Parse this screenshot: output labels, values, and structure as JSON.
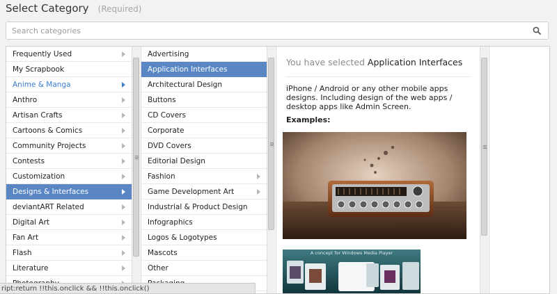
{
  "header": {
    "title": "Select Category",
    "required": "(Required)"
  },
  "search": {
    "placeholder": "Search categories",
    "value": "",
    "icon": "search-icon"
  },
  "columns": {
    "categories": [
      {
        "label": "Frequently Used",
        "has_children": true
      },
      {
        "label": "My Scrapbook",
        "has_children": false
      },
      {
        "label": "Anime & Manga",
        "has_children": true,
        "state": "active"
      },
      {
        "label": "Anthro",
        "has_children": true
      },
      {
        "label": "Artisan Crafts",
        "has_children": true
      },
      {
        "label": "Cartoons & Comics",
        "has_children": true
      },
      {
        "label": "Community Projects",
        "has_children": true
      },
      {
        "label": "Contests",
        "has_children": true
      },
      {
        "label": "Customization",
        "has_children": true
      },
      {
        "label": "Designs & Interfaces",
        "has_children": true,
        "state": "selected"
      },
      {
        "label": "deviantART Related",
        "has_children": true
      },
      {
        "label": "Digital Art",
        "has_children": true
      },
      {
        "label": "Fan Art",
        "has_children": true
      },
      {
        "label": "Flash",
        "has_children": true
      },
      {
        "label": "Literature",
        "has_children": true
      },
      {
        "label": "Photography",
        "has_children": true
      }
    ],
    "subcategories": [
      {
        "label": "Advertising",
        "has_children": false
      },
      {
        "label": "Application Interfaces",
        "has_children": false,
        "state": "selected"
      },
      {
        "label": "Architectural Design",
        "has_children": false
      },
      {
        "label": "Buttons",
        "has_children": false
      },
      {
        "label": "CD Covers",
        "has_children": false
      },
      {
        "label": "Corporate",
        "has_children": false
      },
      {
        "label": "DVD Covers",
        "has_children": false
      },
      {
        "label": "Editorial Design",
        "has_children": false
      },
      {
        "label": "Fashion",
        "has_children": true
      },
      {
        "label": "Game Development Art",
        "has_children": true
      },
      {
        "label": "Industrial & Product Design",
        "has_children": false
      },
      {
        "label": "Infographics",
        "has_children": false
      },
      {
        "label": "Logos & Logotypes",
        "has_children": false
      },
      {
        "label": "Mascots",
        "has_children": false
      },
      {
        "label": "Other",
        "has_children": false
      },
      {
        "label": "Packaging",
        "has_children": false
      }
    ]
  },
  "detail": {
    "prefix": "You have selected",
    "selected": "Application Interfaces",
    "description": "iPhone / Android or any other mobile apps designs. Including design of the web apps / desktop apps like Admin Screen.",
    "examples_label": "Examples:",
    "example2_caption": "A concept for Windows Media Player"
  },
  "status_bar": {
    "text": "ript:return !!this.onclick && !!this.onclick()"
  },
  "colors": {
    "selection": "#5a87c4",
    "active_link": "#3a7fce",
    "muted": "#a5a5a5"
  }
}
